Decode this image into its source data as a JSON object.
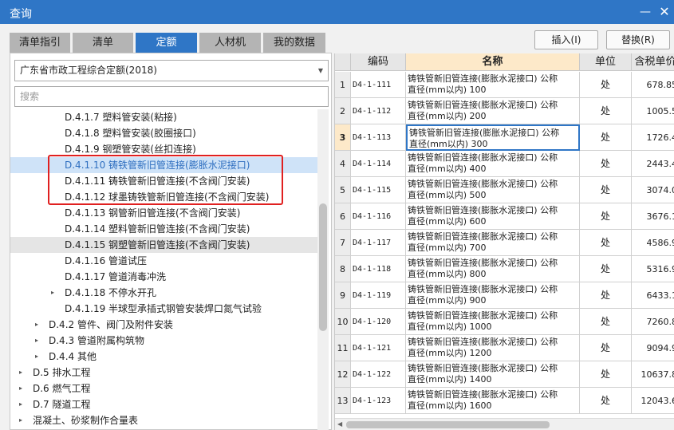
{
  "window": {
    "title": "查询",
    "minimize_glyph": "—",
    "close_glyph": "✕"
  },
  "tabs": [
    {
      "label": "清单指引",
      "active": false
    },
    {
      "label": "清单",
      "active": false
    },
    {
      "label": "定额",
      "active": true
    },
    {
      "label": "人材机",
      "active": false
    },
    {
      "label": "我的数据",
      "active": false
    }
  ],
  "buttons": {
    "insert": "插入(I)",
    "replace": "替换(R)"
  },
  "left": {
    "quota_library": "广东省市政工程综合定额(2018)",
    "search_placeholder": "搜索",
    "tree": [
      {
        "label": "D.4.1.7  塑料管安装(粘接)",
        "state": "normal",
        "arrow": ""
      },
      {
        "label": "D.4.1.8  塑料管安装(胶圈接口)",
        "state": "normal",
        "arrow": ""
      },
      {
        "label": "D.4.1.9  钢塑管安装(丝扣连接)",
        "state": "normal",
        "arrow": ""
      },
      {
        "label": "D.4.1.10  铸铁管新旧管连接(膨胀水泥接口)",
        "state": "selected",
        "arrow": ""
      },
      {
        "label": "D.4.1.11  铸铁管新旧管连接(不含阀门安装)",
        "state": "normal",
        "arrow": ""
      },
      {
        "label": "D.4.1.12  球墨铸铁管新旧管连接(不含阀门安装)",
        "state": "normal",
        "arrow": ""
      },
      {
        "label": "D.4.1.13  钢管新旧管连接(不含阀门安装)",
        "state": "normal",
        "arrow": ""
      },
      {
        "label": "D.4.1.14  塑料管新旧管连接(不含阀门安装)",
        "state": "normal",
        "arrow": ""
      },
      {
        "label": "D.4.1.15  钢塑管新旧管连接(不含阀门安装)",
        "state": "hover",
        "arrow": ""
      },
      {
        "label": "D.4.1.16  管道试压",
        "state": "normal",
        "arrow": ""
      },
      {
        "label": "D.4.1.17  管道消毒冲洗",
        "state": "normal",
        "arrow": ""
      },
      {
        "label": "D.4.1.18  不停水开孔",
        "state": "normal",
        "arrow": "▸"
      },
      {
        "label": "D.4.1.19  半球型承插式钢管安装焊口氮气试验",
        "state": "normal",
        "arrow": ""
      },
      {
        "label": "D.4.2  管件、阀门及附件安装",
        "state": "normal",
        "arrow": "▸"
      },
      {
        "label": "D.4.3  管道附属构筑物",
        "state": "normal",
        "arrow": "▸"
      },
      {
        "label": "D.4.4  其他",
        "state": "normal",
        "arrow": "▸"
      },
      {
        "label": "D.5  排水工程",
        "state": "normal",
        "arrow": "▸"
      },
      {
        "label": "D.6  燃气工程",
        "state": "normal",
        "arrow": "▸"
      },
      {
        "label": "D.7  隧道工程",
        "state": "normal",
        "arrow": "▸"
      },
      {
        "label": "混凝土、砂浆制作合量表",
        "state": "normal",
        "arrow": "▸"
      }
    ]
  },
  "grid": {
    "columns": [
      "",
      "编码",
      "名称",
      "单位",
      "含税单价"
    ],
    "current_row": 3,
    "rows": [
      {
        "num": "1",
        "code": "D4-1-111",
        "name1": "铸铁管新旧管连接(膨胀水泥接口) 公称",
        "name2": "直径(mm以内) 100",
        "unit": "处",
        "price": "678.85"
      },
      {
        "num": "2",
        "code": "D4-1-112",
        "name1": "铸铁管新旧管连接(膨胀水泥接口) 公称",
        "name2": "直径(mm以内) 200",
        "unit": "处",
        "price": "1005.5"
      },
      {
        "num": "3",
        "code": "D4-1-113",
        "name1": "铸铁管新旧管连接(膨胀水泥接口) 公称",
        "name2": "直径(mm以内) 300",
        "unit": "处",
        "price": "1726.4"
      },
      {
        "num": "4",
        "code": "D4-1-114",
        "name1": "铸铁管新旧管连接(膨胀水泥接口) 公称",
        "name2": "直径(mm以内) 400",
        "unit": "处",
        "price": "2443.4"
      },
      {
        "num": "5",
        "code": "D4-1-115",
        "name1": "铸铁管新旧管连接(膨胀水泥接口) 公称",
        "name2": "直径(mm以内) 500",
        "unit": "处",
        "price": "3074.0"
      },
      {
        "num": "6",
        "code": "D4-1-116",
        "name1": "铸铁管新旧管连接(膨胀水泥接口) 公称",
        "name2": "直径(mm以内) 600",
        "unit": "处",
        "price": "3676.1"
      },
      {
        "num": "7",
        "code": "D4-1-117",
        "name1": "铸铁管新旧管连接(膨胀水泥接口) 公称",
        "name2": "直径(mm以内) 700",
        "unit": "处",
        "price": "4586.9"
      },
      {
        "num": "8",
        "code": "D4-1-118",
        "name1": "铸铁管新旧管连接(膨胀水泥接口) 公称",
        "name2": "直径(mm以内) 800",
        "unit": "处",
        "price": "5316.9"
      },
      {
        "num": "9",
        "code": "D4-1-119",
        "name1": "铸铁管新旧管连接(膨胀水泥接口) 公称",
        "name2": "直径(mm以内) 900",
        "unit": "处",
        "price": "6433.1"
      },
      {
        "num": "10",
        "code": "D4-1-120",
        "name1": "铸铁管新旧管连接(膨胀水泥接口) 公称",
        "name2": "直径(mm以内) 1000",
        "unit": "处",
        "price": "7260.8"
      },
      {
        "num": "11",
        "code": "D4-1-121",
        "name1": "铸铁管新旧管连接(膨胀水泥接口) 公称",
        "name2": "直径(mm以内) 1200",
        "unit": "处",
        "price": "9094.9"
      },
      {
        "num": "12",
        "code": "D4-1-122",
        "name1": "铸铁管新旧管连接(膨胀水泥接口) 公称",
        "name2": "直径(mm以内) 1400",
        "unit": "处",
        "price": "10637.8"
      },
      {
        "num": "13",
        "code": "D4-1-123",
        "name1": "铸铁管新旧管连接(膨胀水泥接口) 公称",
        "name2": "直径(mm以内) 1600",
        "unit": "处",
        "price": "12043.6"
      }
    ]
  },
  "colors": {
    "accent": "#2f76c6",
    "highlight_box": "#e02020",
    "current_cell": "#fde9c9"
  }
}
